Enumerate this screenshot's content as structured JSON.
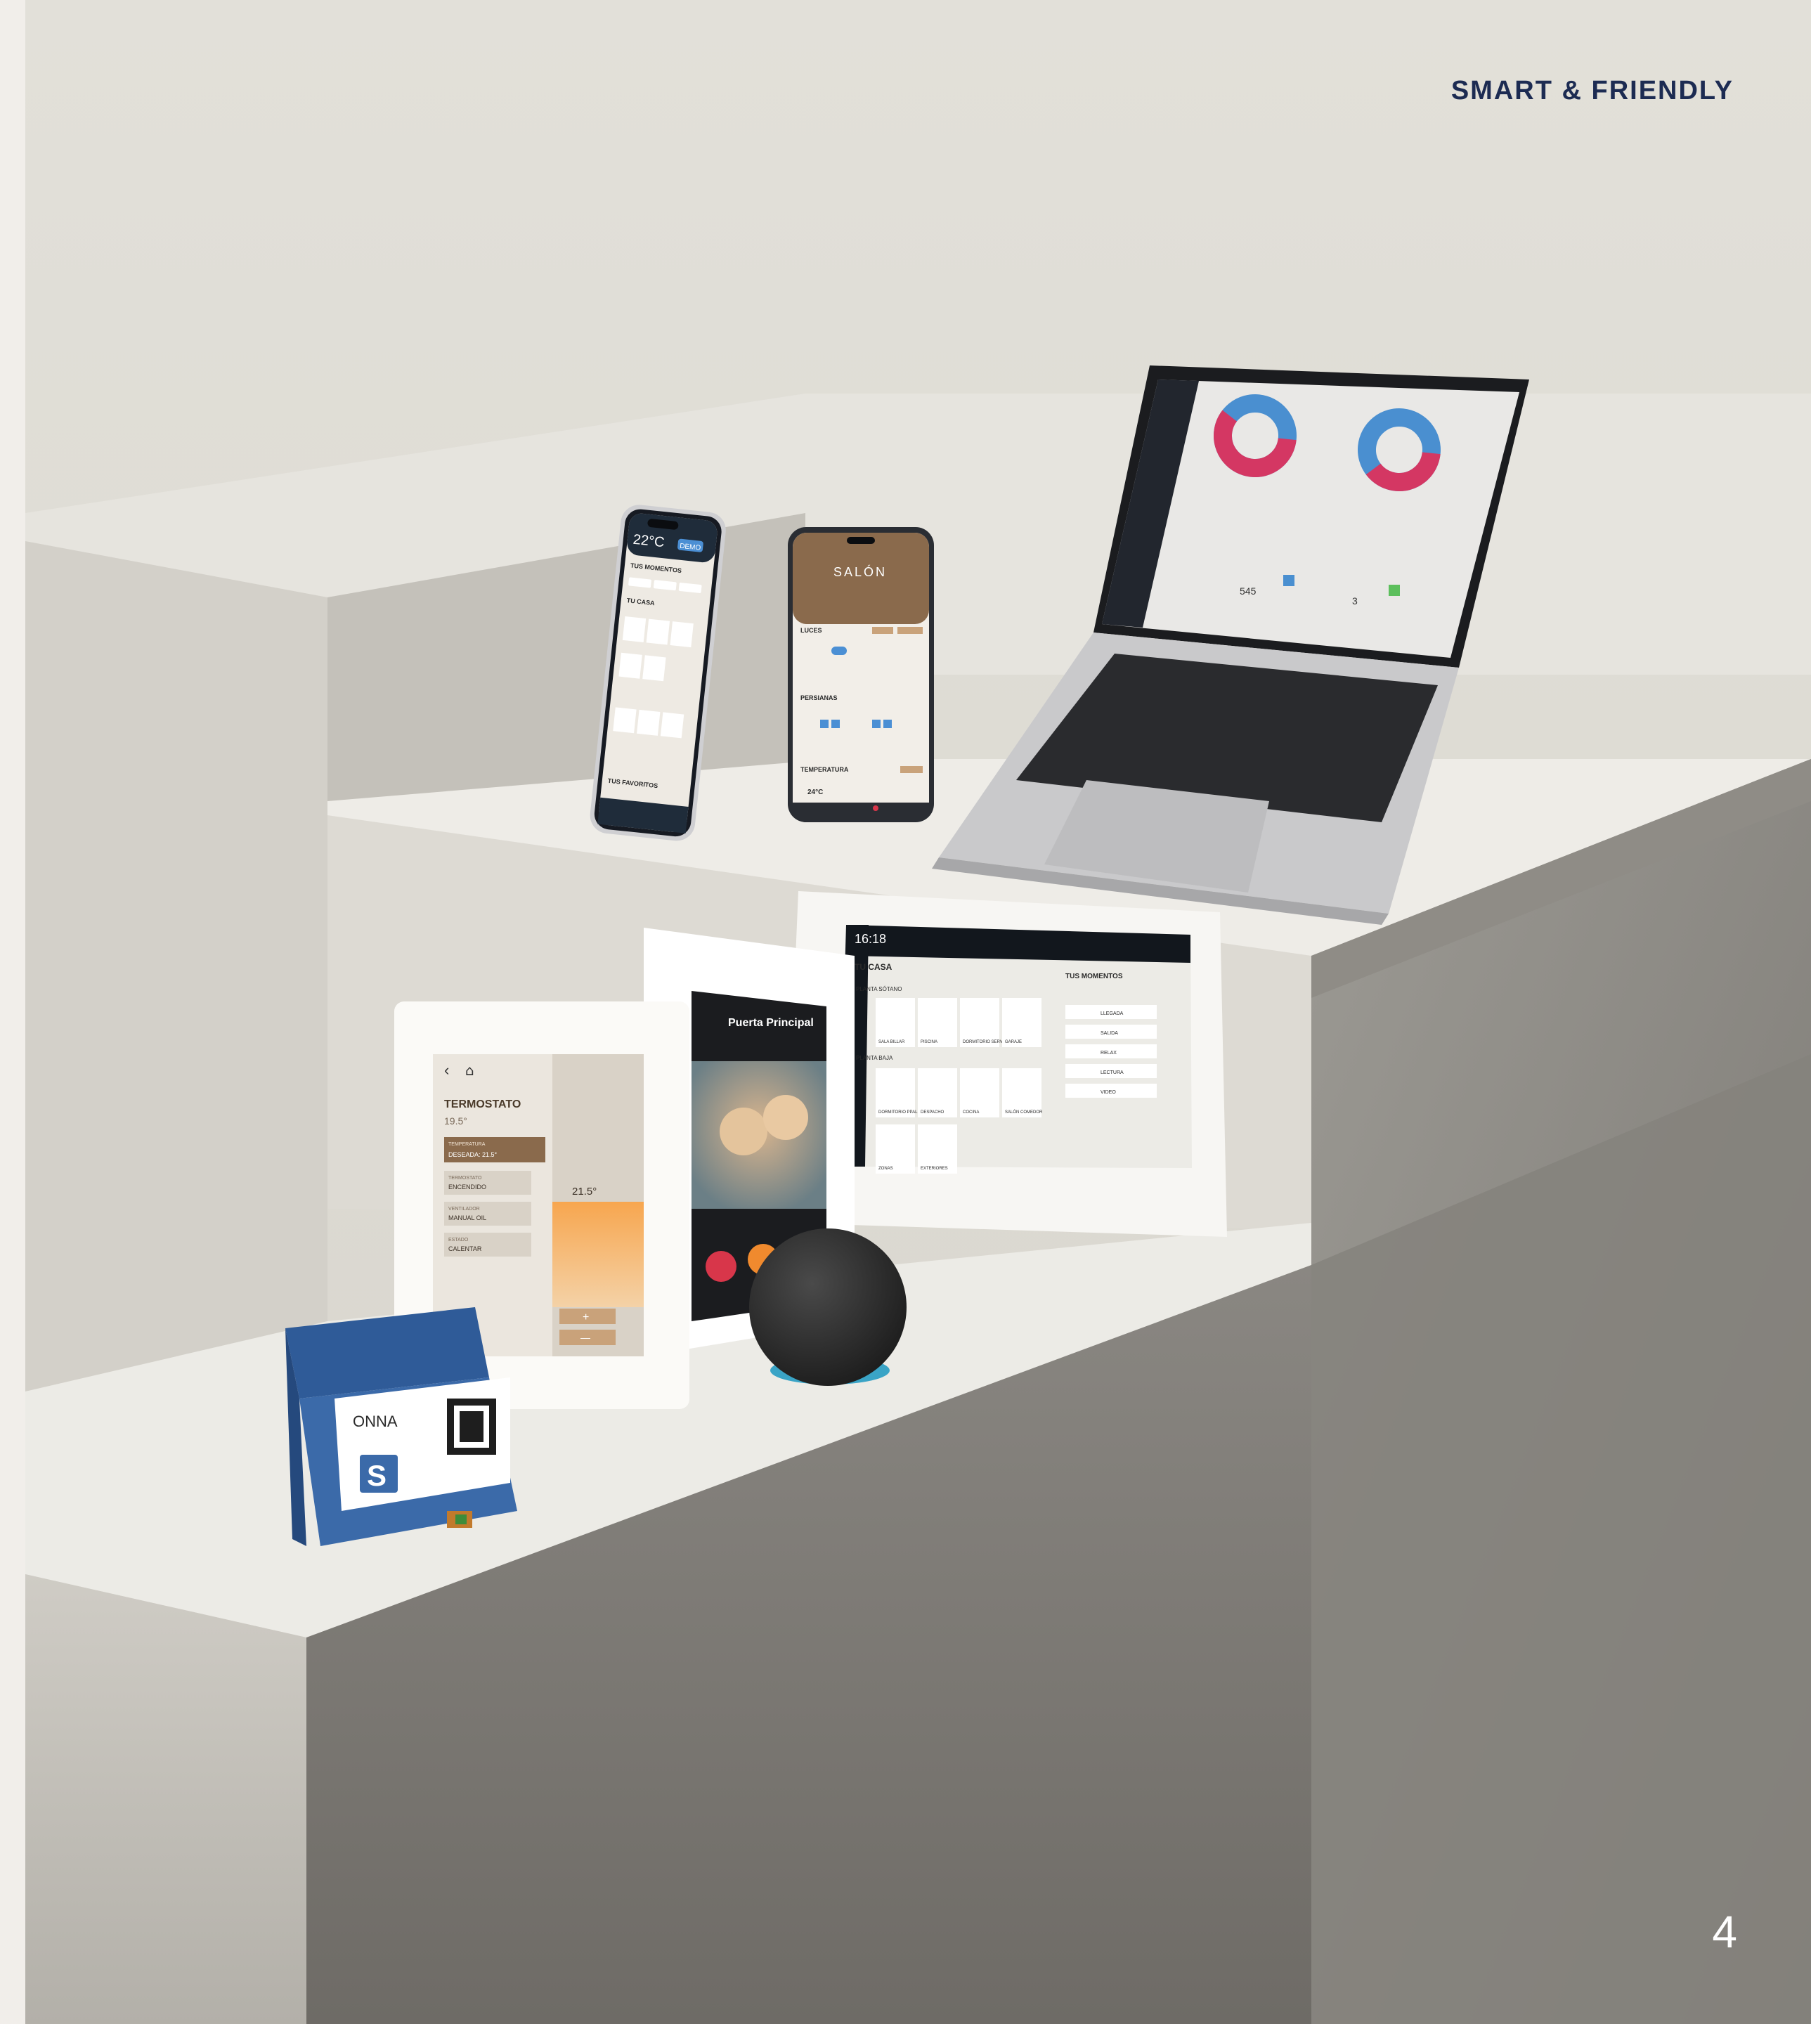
{
  "header": {
    "tagline": "SMART & FRIENDLY"
  },
  "footer": {
    "page_number": "4"
  },
  "colors": {
    "tagline": "#1c2b52",
    "background": "#dcd9d2",
    "accent_blue": "#3f6fb0",
    "accent_orange": "#f08a2e",
    "accent_red": "#d8364a"
  },
  "phone_left": {
    "temperature": "22°C",
    "badge": "DEMO",
    "moments_title": "TUS MOMENTOS",
    "home_title": "TU CASA",
    "favorites_title": "TUS FAVORITOS"
  },
  "phone_right": {
    "room_title": "SALÓN",
    "lights_title": "LUCES",
    "blinds_title": "PERSIANAS",
    "temperature_title": "TEMPERATURA",
    "temperature_value": "24°C"
  },
  "laptop": {
    "stat_1": "545",
    "stat_2": "3"
  },
  "tablet": {
    "time": "16:18",
    "home_title": "TU CASA",
    "moments_title": "TUS MOMENTOS",
    "floor_1": "PLANTA SÓTANO",
    "floor_2": "PLANTA BAJA",
    "rooms": [
      "SALA BILLAR",
      "PISCINA",
      "DORMITORIO SERVICIO",
      "GARAJE",
      "DORMITORIO PPAL.",
      "DESPACHO",
      "COCINA",
      "SALÓN COMEDOR",
      "ZONAS",
      "EXTERIORES"
    ],
    "moments": [
      "LLEGADA",
      "SALIDA",
      "RELAX",
      "LECTURA",
      "VIDEO"
    ]
  },
  "intercom": {
    "title": "Puerta Principal"
  },
  "thermostat": {
    "title": "TERMOSTATO",
    "current": "19.5°",
    "setpoint": "21.5°",
    "desired_label": "TEMPERATURA",
    "desired_value": "DESEADA: 21.5°",
    "state_1_label": "TERMOSTATO",
    "state_1_value": "ENCENDIDO",
    "state_2_label": "VENTILADOR",
    "state_2_value": "MANUAL OIL",
    "state_3_label": "ESTADO",
    "state_3_value": "CALENTAR",
    "plus": "+",
    "minus": "—"
  },
  "controller": {
    "brand": "ONNA",
    "letter": "S"
  }
}
